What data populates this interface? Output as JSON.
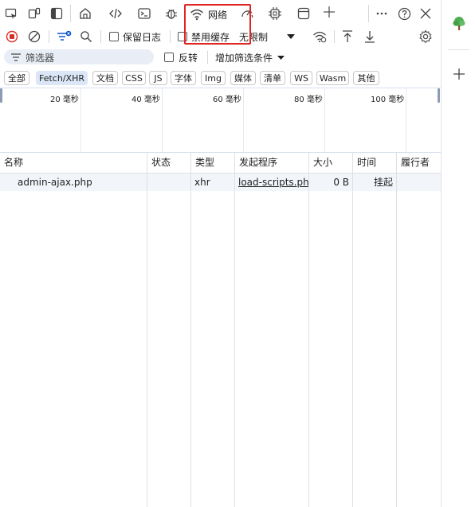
{
  "toolbar": {
    "network_tab_label": "网络"
  },
  "network_toolbar": {
    "preserve_log_label": "保留日志",
    "disable_cache_label": "禁用缓存",
    "throttling_value": "无限制"
  },
  "filter_bar": {
    "filter_placeholder": "筛选器",
    "invert_label": "反转",
    "more_filters_label": "增加筛选条件"
  },
  "type_filters": [
    {
      "label": "全部",
      "active": false
    },
    {
      "label": "Fetch/XHR",
      "active": true
    },
    {
      "label": "文档",
      "active": false
    },
    {
      "label": "CSS",
      "active": false
    },
    {
      "label": "JS",
      "active": false
    },
    {
      "label": "字体",
      "active": false
    },
    {
      "label": "Img",
      "active": false
    },
    {
      "label": "媒体",
      "active": false
    },
    {
      "label": "清单",
      "active": false
    },
    {
      "label": "WS",
      "active": false
    },
    {
      "label": "Wasm",
      "active": false
    },
    {
      "label": "其他",
      "active": false
    }
  ],
  "overview": {
    "ticks": [
      "20 毫秒",
      "40 毫秒",
      "60 毫秒",
      "80 毫秒",
      "100 毫秒"
    ]
  },
  "table": {
    "columns": [
      "名称",
      "状态",
      "类型",
      "发起程序",
      "大小",
      "时间",
      "履行者"
    ],
    "rows": [
      {
        "name": "admin-ajax.php",
        "status": "",
        "type": "xhr",
        "initiator": "load-scripts.php?",
        "size": "0 B",
        "time": "挂起",
        "fulfilled_by": ""
      }
    ]
  },
  "colors": {
    "accent": "#0b57d0",
    "highlight_box": "#e02424",
    "record_red": "#d93025",
    "active_chip": "#dbe7f7"
  },
  "icons": [
    "inspect-icon",
    "device-emulation-icon",
    "dock-icon",
    "welcome-home-icon",
    "elements-icon",
    "console-icon",
    "sources-bug-icon",
    "network-wifi-icon",
    "performance-icon",
    "memory-chip-icon",
    "application-icon",
    "add-tool-icon",
    "more-icon",
    "help-icon",
    "close-icon",
    "record-icon",
    "clear-icon",
    "filter-icon",
    "search-icon",
    "network-conditions-icon",
    "upload-icon",
    "download-icon",
    "settings-icon",
    "tree-icon",
    "plus-icon"
  ]
}
